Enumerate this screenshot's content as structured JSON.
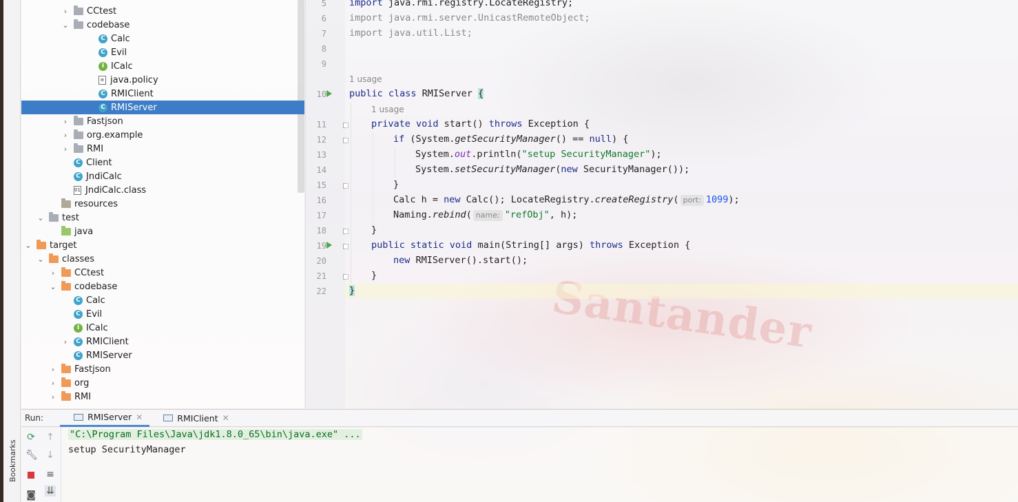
{
  "project_tree": {
    "items": [
      {
        "label": "CCtest",
        "icon": "folder-icon",
        "expandable": true,
        "expanded": false
      },
      {
        "label": "codebase",
        "icon": "folder-icon",
        "expandable": true,
        "expanded": true
      },
      {
        "label": "Calc",
        "icon": "class-icon"
      },
      {
        "label": "Evil",
        "icon": "class-icon"
      },
      {
        "label": "ICalc",
        "icon": "interface-icon"
      },
      {
        "label": "java.policy",
        "icon": "file-icon"
      },
      {
        "label": "RMIClient",
        "icon": "class-icon"
      },
      {
        "label": "RMIServer",
        "icon": "class-icon",
        "selected": true
      },
      {
        "label": "Fastjson",
        "icon": "folder-icon",
        "expandable": true,
        "expanded": false
      },
      {
        "label": "org.example",
        "icon": "folder-icon",
        "expandable": true,
        "expanded": false
      },
      {
        "label": "RMI",
        "icon": "folder-icon",
        "expandable": true,
        "expanded": false
      },
      {
        "label": "Client",
        "icon": "class-icon"
      },
      {
        "label": "JndiCalc",
        "icon": "class-icon"
      },
      {
        "label": "JndiCalc.class",
        "icon": "binary-file-icon"
      },
      {
        "label": "resources",
        "icon": "resources-folder-icon"
      },
      {
        "label": "test",
        "icon": "folder-icon",
        "expandable": true,
        "expanded": true
      },
      {
        "label": "java",
        "icon": "test-folder-icon"
      },
      {
        "label": "target",
        "icon": "excluded-folder-icon",
        "expandable": true,
        "expanded": true
      },
      {
        "label": "classes",
        "icon": "excluded-folder-icon",
        "expandable": true,
        "expanded": true
      },
      {
        "label": "CCtest",
        "icon": "excluded-folder-icon",
        "expandable": true,
        "expanded": false
      },
      {
        "label": "codebase",
        "icon": "excluded-folder-icon",
        "expandable": true,
        "expanded": true
      },
      {
        "label": "Calc",
        "icon": "class-icon"
      },
      {
        "label": "Evil",
        "icon": "class-icon"
      },
      {
        "label": "ICalc",
        "icon": "interface-icon"
      },
      {
        "label": "RMIClient",
        "icon": "class-icon",
        "expandable": true,
        "expanded": false
      },
      {
        "label": "RMIServer",
        "icon": "class-icon"
      },
      {
        "label": "Fastjson",
        "icon": "excluded-folder-icon",
        "expandable": true,
        "expanded": false
      },
      {
        "label": "org",
        "icon": "excluded-folder-icon",
        "expandable": true,
        "expanded": false
      },
      {
        "label": "RMI",
        "icon": "excluded-folder-icon",
        "expandable": true,
        "expanded": false
      }
    ]
  },
  "editor": {
    "line_numbers": [
      "5",
      "6",
      "7",
      "8",
      "9",
      "10",
      "11",
      "12",
      "13",
      "14",
      "15",
      "16",
      "17",
      "18",
      "19",
      "20",
      "21",
      "22"
    ],
    "usage_hint_class": "1 usage",
    "usage_hint_method": "1 usage",
    "lines": {
      "l5": [
        "import",
        " java.rmi.registry.LocateRegistry;"
      ],
      "l6": "import java.rmi.server.UnicastRemoteObject;",
      "l7": "import java.util.List;",
      "l10": [
        "public class",
        " RMIServer ",
        "{"
      ],
      "l11": [
        "private void",
        " start() ",
        "throws",
        " Exception {"
      ],
      "l12": [
        "if",
        " (System.",
        "getSecurityManager",
        "() == ",
        "null",
        ") {"
      ],
      "l13": [
        "System.",
        "out",
        ".println(",
        "\"setup SecurityManager\"",
        ");"
      ],
      "l14": [
        "System.",
        "setSecurityManager",
        "(",
        "new",
        " SecurityManager());"
      ],
      "l15": "}",
      "l16": [
        "Calc h = ",
        "new",
        " Calc(); LocateRegistry.",
        "createRegistry",
        "(",
        "port:",
        "1099",
        ");"
      ],
      "l17": [
        "Naming.",
        "rebind",
        "(",
        "name:",
        "\"refObj\"",
        ", h);"
      ],
      "l18": "}",
      "l19": [
        "public static void",
        " main(String[] args) ",
        "throws",
        " Exception {"
      ],
      "l20": [
        "new",
        " RMIServer().start();"
      ],
      "l21": "}",
      "l22": "}"
    },
    "watermark": "Santander"
  },
  "run_panel": {
    "title": "Run:",
    "tabs": [
      {
        "label": "RMIServer",
        "active": true
      },
      {
        "label": "RMIClient",
        "active": false
      }
    ],
    "console": [
      "\"C:\\Program Files\\Java\\jdk1.8.0_65\\bin\\java.exe\" ...",
      "setup SecurityManager"
    ]
  },
  "side_stripe": {
    "bookmarks_label": "Bookmarks"
  },
  "colors": {
    "selection": "#3d7cc7",
    "keyword": "#1b2b8c",
    "string": "#0e7a2c",
    "number": "#1750eb",
    "run_icon": "#4aa84a"
  }
}
